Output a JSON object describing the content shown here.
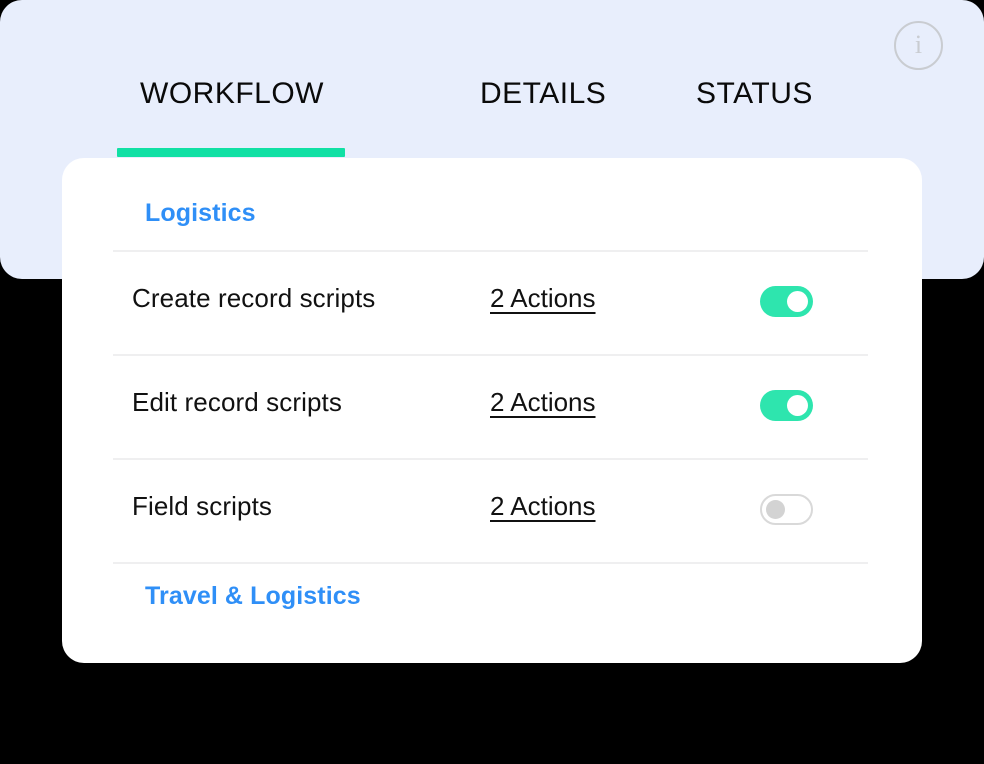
{
  "panel": {
    "background_color": "#E8EEFC",
    "info_icon": {
      "name": "info-icon",
      "glyph": "i"
    },
    "tabs": [
      {
        "label": "WORKFLOW",
        "active": true
      },
      {
        "label": "DETAILS",
        "active": false
      },
      {
        "label": "STATUS",
        "active": false
      }
    ],
    "active_indicator_color": "#11E0A4"
  },
  "card": {
    "background_color": "#FFFFFF",
    "group_top": {
      "label": "Logistics",
      "color": "#2F8FF7"
    },
    "group_bottom": {
      "label": "Travel & Logistics",
      "color": "#2F8FF7"
    },
    "rows": [
      {
        "label": "Create record scripts",
        "actions_label": "2 Actions",
        "toggle_state": "on"
      },
      {
        "label": "Edit record scripts",
        "actions_label": "2 Actions",
        "toggle_state": "on"
      },
      {
        "label": "Field scripts",
        "actions_label": "2 Actions",
        "toggle_state": "off"
      }
    ],
    "toggle_on_color": "#2EE5AE",
    "toggle_off_color": "#D9D9D9"
  }
}
